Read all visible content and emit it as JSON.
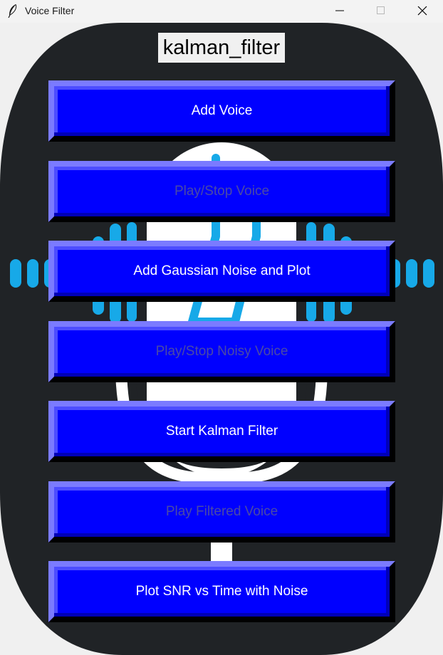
{
  "window": {
    "title": "Voice Filter"
  },
  "heading": {
    "text": "kalman_filter"
  },
  "buttons": [
    {
      "label": "Add Voice",
      "enabled": true
    },
    {
      "label": "Play/Stop Voice",
      "enabled": false
    },
    {
      "label": "Add Gaussian Noise and Plot",
      "enabled": true
    },
    {
      "label": "Play/Stop Noisy Voice",
      "enabled": false
    },
    {
      "label": "Start Kalman Filter",
      "enabled": true
    },
    {
      "label": "Play Filtered Voice",
      "enabled": false
    },
    {
      "label": "Plot SNR vs Time with Noise",
      "enabled": true
    }
  ],
  "icons": {
    "app": "feather-icon",
    "background": "microphone-soundwave-icon"
  },
  "colors": {
    "button_face": "#0000ff",
    "button_text": "#ffffff",
    "button_text_disabled": "#4a4aa6",
    "background_art": "#202326",
    "soundwave": "#17a9e8",
    "microphone": "#ffffff"
  }
}
